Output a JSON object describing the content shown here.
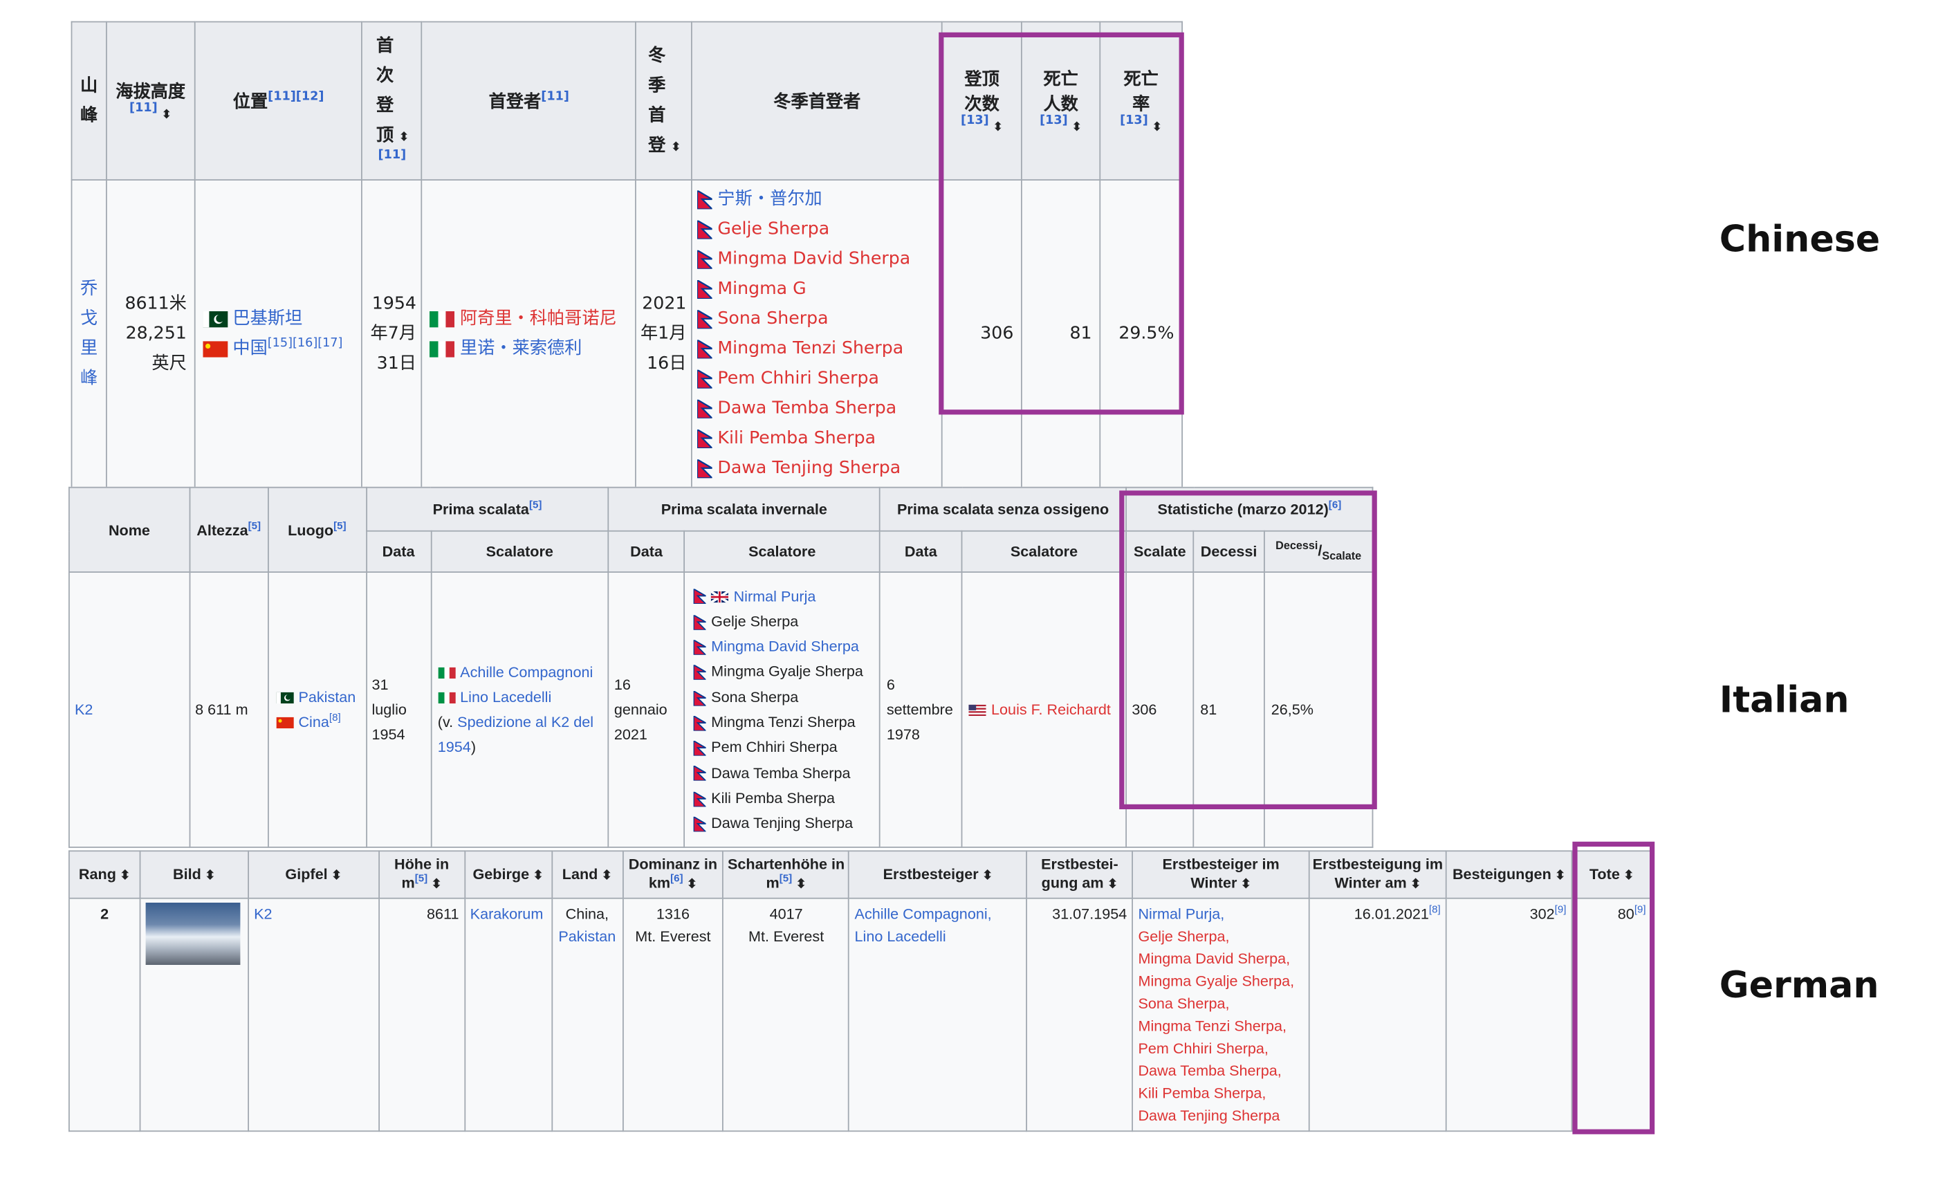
{
  "zh": {
    "h_mountain": "山峰",
    "h_elev": "海拔高度",
    "h_elev_ref": "[11]",
    "h_loc": "位置",
    "h_loc_ref": "[11][12]",
    "h_first": "首次登顶",
    "h_first_ref": "[11]",
    "h_firstby": "首登者",
    "h_firstby_ref": "[11]",
    "h_winter": "冬季首登",
    "h_winterby": "冬季首登者",
    "h_ascents": "登顶次数",
    "h_ascents_ref": "[13]",
    "h_deaths": "死亡人数",
    "h_deaths_ref": "[13]",
    "h_rate": "死亡率",
    "h_rate_ref": "[13]",
    "mountain": "乔戈里峰",
    "elev_m": "8611米",
    "elev_ft": "28,251",
    "elev_ft_unit": "英尺",
    "loc1": "巴基斯坦",
    "loc2": "中国",
    "loc2_ref": "[15][16][17]",
    "first_date": "1954年7月31日",
    "climber1": "阿奇里・科帕哥诺尼",
    "climber2": "里诺・莱索德利",
    "winter_date": "2021年1月16日",
    "winter_climbers": [
      "宁斯・普尔加",
      "Gelje Sherpa",
      "Mingma David Sherpa",
      "Mingma G",
      "Sona Sherpa",
      "Mingma Tenzi Sherpa",
      "Pem Chhiri Sherpa",
      "Dawa Temba Sherpa",
      "Kili Pemba Sherpa",
      "Dawa Tenjing Sherpa"
    ],
    "ascents": "306",
    "deaths": "81",
    "rate": "29.5%"
  },
  "it": {
    "h_nome": "Nome",
    "h_altezza": "Altezza",
    "h_altezza_ref": "[5]",
    "h_luogo": "Luogo",
    "h_luogo_ref": "[5]",
    "h_prima": "Prima scalata",
    "h_prima_ref": "[5]",
    "h_invernale": "Prima scalata invernale",
    "h_ossigeno": "Prima scalata senza ossigeno",
    "h_stat": "Statistiche (marzo 2012)",
    "h_stat_ref": "[6]",
    "h_data": "Data",
    "h_scalatore": "Scalatore",
    "h_scalate": "Scalate",
    "h_decessi": "Decessi",
    "h_ratio_num": "Decessi",
    "h_ratio_den": "Scalate",
    "nome": "K2",
    "altezza": "8 611 m",
    "luogo1": "Pakistan",
    "luogo2": "Cina",
    "luogo2_ref": "[8]",
    "prima_data": "31 luglio 1954",
    "prima_sc1": "Achille Compagnoni",
    "prima_sc2": "Lino Lacedelli",
    "prima_note_a": "(v. ",
    "prima_note_link": "Spedizione al K2 del 1954",
    "prima_note_b": ")",
    "inv_data": "16 gennaio 2021",
    "inv_climbers": [
      "Nirmal Purja",
      "Gelje Sherpa",
      "Mingma David Sherpa",
      "Mingma Gyalje Sherpa",
      "Sona Sherpa",
      "Mingma Tenzi Sherpa",
      "Pem Chhiri Sherpa",
      "Dawa Temba Sherpa",
      "Kili Pemba Sherpa",
      "Dawa Tenjing Sherpa"
    ],
    "oss_data": "6 settembre 1978",
    "oss_sc": "Louis F. Reichardt",
    "scalate": "306",
    "decessi": "81",
    "ratio": "26,5%"
  },
  "de": {
    "h_rang": "Rang",
    "h_bild": "Bild",
    "h_gipfel": "Gipfel",
    "h_hoehe": "Höhe in m",
    "h_hoehe_ref": "[5]",
    "h_gebirge": "Gebirge",
    "h_land": "Land",
    "h_dominanz": "Dominanz in km",
    "h_dominanz_ref": "[6]",
    "h_schartenhoehe": "Schartenhöhe in m",
    "h_schartenhoehe_ref": "[5]",
    "h_erstbesteiger": "Erstbesteiger",
    "h_erstbesteigung": "Erstbestei-gung am",
    "h_winter": "Erstbesteiger im Winter",
    "h_winter_date": "Erstbesteigung im Winter am",
    "h_besteigungen": "Besteigungen",
    "h_tote": "Tote",
    "rang": "2",
    "gipfel": "K2",
    "hoehe": "8611",
    "gebirge": "Karakorum",
    "land1": "China,",
    "land2": "Pakistan",
    "dominanz": "1316",
    "dominanz_ref": "Mt. Everest",
    "scharten": "4017",
    "scharten_ref": "Mt. Everest",
    "erst1": "Achille Compagnoni,",
    "erst2": "Lino Lacedelli",
    "erst_date": "31.07.1954",
    "winter_climbers": [
      "Nirmal Purja,",
      "Gelje Sherpa,",
      "Mingma David Sherpa,",
      "Mingma Gyalje Sherpa,",
      "Sona Sherpa,",
      "Mingma Tenzi Sherpa,",
      "Pem Chhiri Sherpa,",
      "Dawa Temba Sherpa,",
      "Kili Pemba Sherpa,",
      "Dawa Tenjing Sherpa"
    ],
    "winter_date": "16.01.2021",
    "winter_date_ref": "[8]",
    "besteigungen": "302",
    "besteigungen_ref": "[9]",
    "tote": "80",
    "tote_ref": "[9]"
  },
  "labels": {
    "chinese": "Chinese",
    "italian": "Italian",
    "german": "German"
  },
  "colors": {
    "highlight": "#9b3596",
    "link": "#3366cc",
    "redlink": "#dd3333",
    "header_bg": "#eaecf0"
  }
}
